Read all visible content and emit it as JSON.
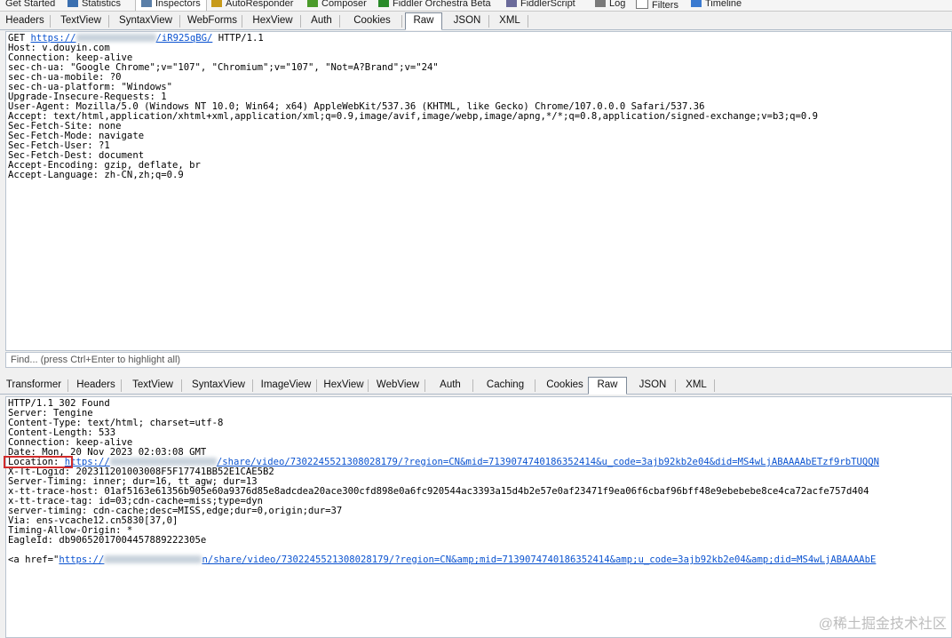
{
  "top_tabs": [
    "Get Started",
    "Statistics",
    "Inspectors",
    "AutoResponder",
    "Composer",
    "Fiddler Orchestra Beta",
    "FiddlerScript",
    "Log",
    "Filters",
    "Timeline"
  ],
  "request_tabs": [
    "Headers",
    "TextView",
    "SyntaxView",
    "WebForms",
    "HexView",
    "Auth",
    "Cookies",
    "Raw",
    "JSON",
    "XML"
  ],
  "request_active": "Raw",
  "request_lines": [
    "GET ",
    "Host: v.douyin.com",
    "Connection: keep-alive",
    "sec-ch-ua: \"Google Chrome\";v=\"107\", \"Chromium\";v=\"107\", \"Not=A?Brand\";v=\"24\"",
    "sec-ch-ua-mobile: ?0",
    "sec-ch-ua-platform: \"Windows\"",
    "Upgrade-Insecure-Requests: 1",
    "User-Agent: Mozilla/5.0 (Windows NT 10.0; Win64; x64) AppleWebKit/537.36 (KHTML, like Gecko) Chrome/107.0.0.0 Safari/537.36",
    "Accept: text/html,application/xhtml+xml,application/xml;q=0.9,image/avif,image/webp,image/apng,*/*;q=0.8,application/signed-exchange;v=b3;q=0.9",
    "Sec-Fetch-Site: none",
    "Sec-Fetch-Mode: navigate",
    "Sec-Fetch-User: ?1",
    "Sec-Fetch-Dest: document",
    "Accept-Encoding: gzip, deflate, br",
    "Accept-Language: zh-CN,zh;q=0.9"
  ],
  "request_url_start": "https://",
  "request_url_end": "/iR925qBG/",
  "request_protocol": " HTTP/1.1",
  "find_placeholder": "Find... (press Ctrl+Enter to highlight all)",
  "response_tabs": [
    "Transformer",
    "Headers",
    "TextView",
    "SyntaxView",
    "ImageView",
    "HexView",
    "WebView",
    "Auth",
    "Caching",
    "Cookies",
    "Raw",
    "JSON",
    "XML"
  ],
  "response_active": "Raw",
  "response_lines_a": [
    "HTTP/1.1 302 Found",
    "Server: Tengine",
    "Content-Type: text/html; charset=utf-8",
    "Content-Length: 533",
    "Connection: keep-alive",
    "Date: Mon, 20 Nov 2023 02:03:08 GMT"
  ],
  "location_label": "Location: ",
  "location_url_start": "https://",
  "location_url_end": "/share/video/7302245521308028179/?region=CN&mid=7139074740186352414&u_code=3ajb92kb2e04&did=MS4wLjABAAAAbETzf9rbTUQQN",
  "response_lines_b": [
    "X-Tt-Logid: 202311201003008F5F17741BB52E1CAE5B2",
    "Server-Timing: inner; dur=16, tt_agw; dur=13",
    "x-tt-trace-host: 01af5163e61356b905e60a9376d85e8adcdea20ace300cfd898e0a6fc920544ac3393a15d4b2e57e0af23471f9ea06f6cbaf96bff48e9ebebebe8ce4ca72acfe757d404",
    "x-tt-trace-tag: id=03;cdn-cache=miss;type=dyn",
    "server-timing: cdn-cache;desc=MISS,edge;dur=0,origin;dur=37",
    "Via: ens-vcache12.cn5830[37,0]",
    "Timing-Allow-Origin: *",
    "EagleId: db90652017004457889222305e"
  ],
  "href_prefix": "<a href=\"",
  "href_url_start": "https://",
  "href_url_end": "n/share/video/7302245521308028179/?region=CN&amp;mid=7139074740186352414&amp;u_code=3ajb92kb2e04&amp;did=MS4wLjABAAAAbE",
  "watermark": "@稀土掘金技术社区"
}
